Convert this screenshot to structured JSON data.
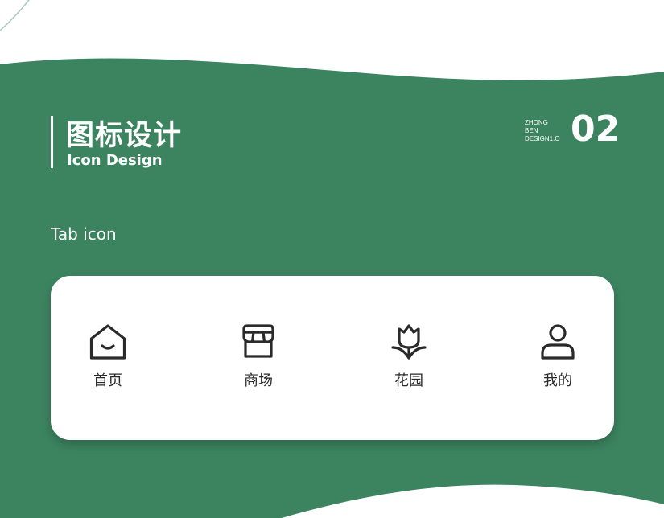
{
  "colors": {
    "primary": "#3c8460",
    "card_bg": "#ffffff",
    "text_dark": "#2a2a2a",
    "text_light": "#ffffff"
  },
  "header": {
    "title_cn": "图标设计",
    "title_en": "Icon Design",
    "brand_lines": [
      "ZHONG",
      "BEN",
      "DESIGN1.O"
    ],
    "page_number": "02"
  },
  "section": {
    "label": "Tab icon"
  },
  "tabs": [
    {
      "label": "首页",
      "icon": "home-icon"
    },
    {
      "label": "商场",
      "icon": "store-icon"
    },
    {
      "label": "花园",
      "icon": "flower-icon"
    },
    {
      "label": "我的",
      "icon": "user-icon"
    }
  ]
}
